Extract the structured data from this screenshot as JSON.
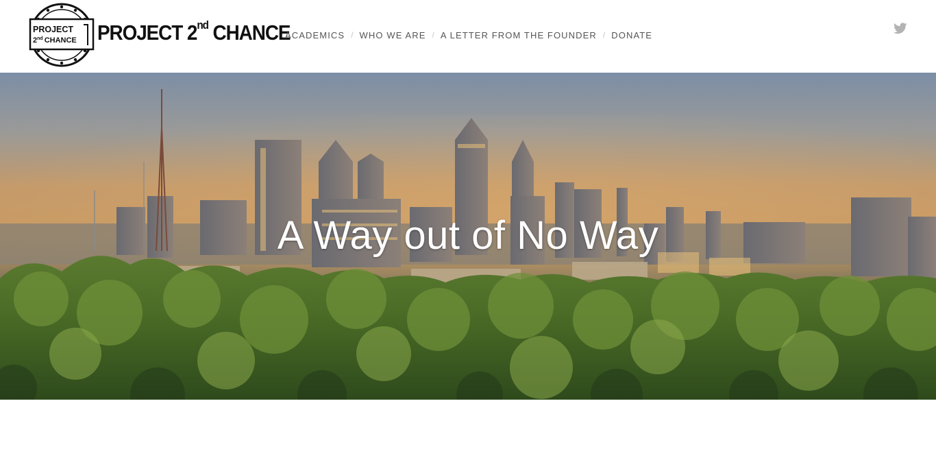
{
  "brand": {
    "seal_line1": "PROJECT",
    "seal_line2_sup": "nd",
    "seal_line2_num": "2",
    "seal_line2": "CHANCE",
    "wordmark_main": "PROJECT 2",
    "wordmark_sup": "nd",
    "wordmark_end": " CHANCE"
  },
  "nav": {
    "items": [
      {
        "label": "ACADEMICS"
      },
      {
        "label": "WHO WE ARE"
      },
      {
        "label": "A LETTER FROM THE FOUNDER"
      },
      {
        "label": "DONATE"
      }
    ],
    "separator": "/"
  },
  "social": {
    "icon": "twitter-icon",
    "color": "#b3b3b3"
  },
  "hero": {
    "title": "A Way out of No Way",
    "image": "city-skyline-over-treetops"
  },
  "colors": {
    "nav_text": "#555555",
    "separator": "#c6c6c6",
    "hero_text": "#ffffff"
  }
}
